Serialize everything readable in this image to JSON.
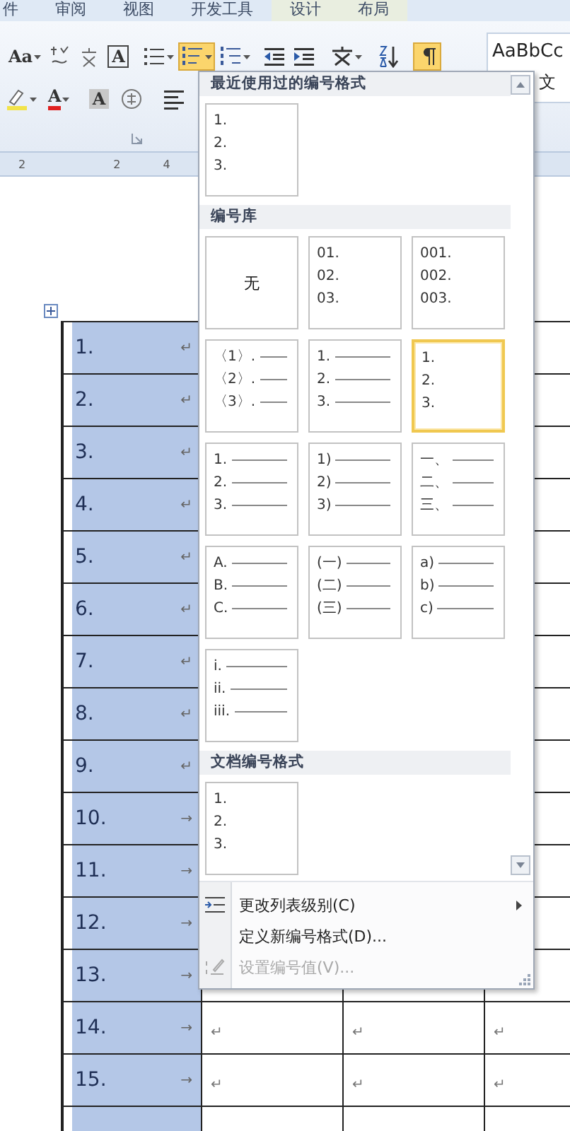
{
  "ribbon": {
    "tabs": [
      {
        "label": "件",
        "kind": "normal"
      },
      {
        "label": "审阅",
        "kind": "normal"
      },
      {
        "label": "视图",
        "kind": "normal"
      },
      {
        "label": "开发工具",
        "kind": "normal"
      },
      {
        "label": "设计",
        "kind": "contextual"
      },
      {
        "label": "布局",
        "kind": "contextual"
      }
    ],
    "row1": [
      {
        "kind": "change-case",
        "text": "Aa",
        "dropdown": true,
        "on": false
      },
      {
        "kind": "phonetic",
        "dropdown": false,
        "on": false
      },
      {
        "kind": "pinyin-guide",
        "dropdown": false,
        "on": false
      },
      {
        "kind": "char-border",
        "text": "A",
        "dropdown": false,
        "on": false
      },
      {
        "kind": "bullets",
        "dropdown": true,
        "on": false
      },
      {
        "kind": "numbering",
        "dropdown": true,
        "on": true
      },
      {
        "kind": "multilevel",
        "dropdown": true,
        "on": false
      },
      {
        "kind": "decrease-indent",
        "dropdown": false,
        "on": false
      },
      {
        "kind": "increase-indent",
        "dropdown": false,
        "on": false
      },
      {
        "kind": "asian-layout",
        "dropdown": true,
        "on": false
      },
      {
        "kind": "sort",
        "dropdown": false,
        "on": false
      },
      {
        "kind": "show-marks",
        "dropdown": false,
        "on": true
      }
    ],
    "row2": [
      {
        "kind": "highlight",
        "dropdown": true,
        "on": false
      },
      {
        "kind": "font-color",
        "text": "A",
        "dropdown": true,
        "on": false
      },
      {
        "kind": "char-shading",
        "text": "A",
        "dropdown": false,
        "on": false
      },
      {
        "kind": "enclosed-char",
        "dropdown": false,
        "on": false
      },
      {
        "kind": "align-left",
        "dropdown": false,
        "on": false
      }
    ],
    "style_preview": "AaBbCc",
    "style_name": "文"
  },
  "ruler": {
    "labels": [
      "2",
      "2",
      "4"
    ]
  },
  "table": {
    "rows": [
      {
        "number": "1.",
        "mark": "↵"
      },
      {
        "number": "2.",
        "mark": "↵"
      },
      {
        "number": "3.",
        "mark": "↵"
      },
      {
        "number": "4.",
        "mark": "↵"
      },
      {
        "number": "5.",
        "mark": "↵"
      },
      {
        "number": "6.",
        "mark": "↵"
      },
      {
        "number": "7.",
        "mark": "↵"
      },
      {
        "number": "8.",
        "mark": "↵"
      },
      {
        "number": "9.",
        "mark": "↵"
      },
      {
        "number": "10.",
        "mark": "→"
      },
      {
        "number": "11.",
        "mark": "→"
      },
      {
        "number": "12.",
        "mark": "→"
      },
      {
        "number": "13.",
        "mark": "→"
      },
      {
        "number": "14.",
        "mark": "→",
        "cells": [
          "↵",
          "↵",
          "↵"
        ]
      },
      {
        "number": "15.",
        "mark": "→",
        "cells": [
          "↵",
          "↵",
          "↵"
        ]
      }
    ]
  },
  "numbering_menu": {
    "sections": [
      {
        "title": "最近使用过的编号格式",
        "items": [
          {
            "kind": "plain",
            "lines": [
              "1.",
              "2.",
              "3."
            ],
            "selected": false
          }
        ]
      },
      {
        "title": "编号库",
        "items": [
          {
            "kind": "none",
            "lines": [
              "无"
            ],
            "selected": false
          },
          {
            "kind": "plain",
            "lines": [
              "01.",
              "02.",
              "03."
            ],
            "selected": false
          },
          {
            "kind": "plain",
            "lines": [
              "001.",
              "002.",
              "003."
            ],
            "selected": false
          },
          {
            "kind": "lined",
            "lines": [
              "〈1〉.",
              "〈2〉.",
              "〈3〉."
            ],
            "selected": false
          },
          {
            "kind": "lined",
            "lines": [
              "1.",
              "2.",
              "3."
            ],
            "selected": false
          },
          {
            "kind": "plain",
            "lines": [
              "1.",
              "2.",
              "3."
            ],
            "selected": true
          },
          {
            "kind": "lined",
            "lines": [
              "1.",
              "2.",
              "3."
            ],
            "selected": false
          },
          {
            "kind": "lined",
            "lines": [
              "1)",
              "2)",
              "3)"
            ],
            "selected": false
          },
          {
            "kind": "lined",
            "lines": [
              "一、",
              "二、",
              "三、"
            ],
            "selected": false
          },
          {
            "kind": "lined",
            "lines": [
              "A.",
              "B.",
              "C."
            ],
            "selected": false
          },
          {
            "kind": "lined",
            "lines": [
              "(一)",
              "(二)",
              "(三)"
            ],
            "selected": false
          },
          {
            "kind": "lined",
            "lines": [
              "a)",
              "b)",
              "c)"
            ],
            "selected": false
          },
          {
            "kind": "lined",
            "lines": [
              "i.",
              "ii.",
              "iii."
            ],
            "selected": false
          }
        ]
      },
      {
        "title": "文档编号格式",
        "items": [
          {
            "kind": "plain",
            "lines": [
              "1.",
              "2.",
              "3."
            ],
            "selected": false
          }
        ]
      }
    ],
    "commands": [
      {
        "kind": "change-level",
        "label": "更改列表级别(C)",
        "submenu": true,
        "disabled": false
      },
      {
        "kind": "define-format",
        "label": "定义新编号格式(D)...",
        "submenu": false,
        "disabled": false
      },
      {
        "kind": "set-value",
        "label": "设置编号值(V)...",
        "submenu": false,
        "disabled": true
      }
    ]
  }
}
